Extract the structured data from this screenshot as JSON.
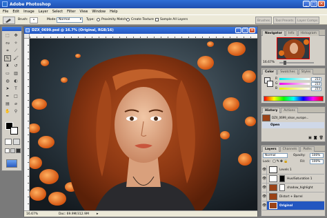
{
  "window": {
    "title": "Adobe Photoshop",
    "min": "_",
    "max": "□",
    "close": "×"
  },
  "menu": [
    "File",
    "Edit",
    "Image",
    "Layer",
    "Select",
    "Filter",
    "View",
    "Window",
    "Help"
  ],
  "options": {
    "brush_label": "Brush:",
    "mode_label": "Mode:",
    "mode_value": "Normal",
    "type_label": "Type:",
    "proximity_match": "Proximity Match",
    "create_texture": "Create Texture",
    "sample_all_layers": "Sample All Layers",
    "well_tabs": [
      "Brushes",
      "Tool Presets",
      "Layer Comps"
    ]
  },
  "document": {
    "title": "DZX_0699.psd @ 16.7% (Original, RGB/16)",
    "zoom": "16.67%",
    "doc_size": "Doc: 69.9M/312.9M"
  },
  "navigator": {
    "tabs": [
      "Navigator",
      "Info",
      "Histogram"
    ],
    "zoom": "16.67%"
  },
  "color": {
    "tabs": [
      "Color",
      "Swatches",
      "Styles"
    ],
    "channels": [
      {
        "label": "R",
        "value": "233"
      },
      {
        "label": "G",
        "value": "233"
      },
      {
        "label": "B",
        "value": "233"
      }
    ],
    "colors": {
      "accent": "#2356c0"
    }
  },
  "history": {
    "tabs": [
      "History",
      "Actions"
    ],
    "snapshot": "DZX_0699_nikon_europe...",
    "items": [
      "Open"
    ]
  },
  "layers": {
    "tabs": [
      "Layers",
      "Channels",
      "Paths"
    ],
    "mode": "Normal",
    "opacity_label": "Opacity:",
    "opacity": "100%",
    "lock_label": "Lock:",
    "fill_label": "Fill:",
    "fill": "100%",
    "items": [
      {
        "name": "Levels 1"
      },
      {
        "name": "Hue/Saturation 1"
      },
      {
        "name": "shadow_highlight"
      },
      {
        "name": "Distort + Barrel"
      },
      {
        "name": "Original"
      }
    ]
  }
}
